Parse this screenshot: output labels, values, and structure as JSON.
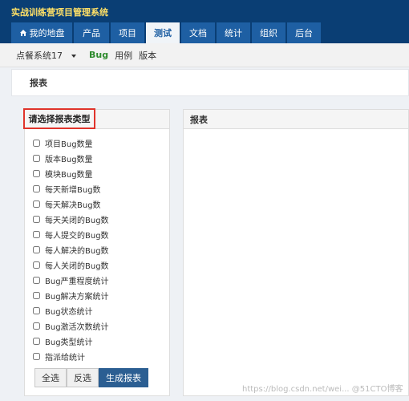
{
  "app_title": "实战训练营项目管理系统",
  "nav": [
    {
      "label": "我的地盘",
      "icon": "home-icon"
    },
    {
      "label": "产品"
    },
    {
      "label": "项目"
    },
    {
      "label": "测试",
      "active": true
    },
    {
      "label": "文档"
    },
    {
      "label": "统计"
    },
    {
      "label": "组织"
    },
    {
      "label": "后台"
    }
  ],
  "subnav": {
    "product": "点餐系统17",
    "bug": "Bug",
    "case": "用例",
    "version": "版本"
  },
  "page_title": "报表",
  "left_panel": {
    "title": "请选择报表类型",
    "items": [
      "项目Bug数量",
      "版本Bug数量",
      "模块Bug数量",
      "每天新增Bug数",
      "每天解决Bug数",
      "每天关闭的Bug数",
      "每人提交的Bug数",
      "每人解决的Bug数",
      "每人关闭的Bug数",
      "Bug严重程度统计",
      "Bug解决方案统计",
      "Bug状态统计",
      "Bug激活次数统计",
      "Bug类型统计",
      "指派给统计"
    ],
    "buttons": {
      "select_all": "全选",
      "invert": "反选",
      "generate": "生成报表"
    }
  },
  "right_panel": {
    "title": "报表"
  },
  "watermark": "https://blog.csdn.net/wei... @51CTO博客",
  "colors": {
    "topbar": "#0a3e74",
    "tab": "#1e5fa3",
    "title": "#ffe066",
    "highlight": "#e0342b",
    "bug": "#2e8b2e"
  }
}
